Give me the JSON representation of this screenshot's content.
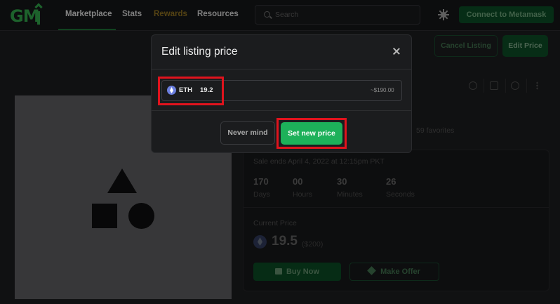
{
  "header": {
    "logo_text": "GM",
    "nav": [
      {
        "label": "Marketplace",
        "color": "#d9d9d9",
        "active": true
      },
      {
        "label": "Stats",
        "color": "#cfcfcf"
      },
      {
        "label": "Rewards",
        "color": "#8a6d1f"
      },
      {
        "label": "Resources",
        "color": "#cfcfcf"
      }
    ],
    "search_placeholder": "Search",
    "theme_icon": "sun-icon",
    "connect_label": "Connect to Metamask"
  },
  "actions": {
    "cancel_label": "Cancel Listing",
    "edit_label": "Edit Price"
  },
  "item": {
    "favorites": "59 favorites",
    "sale_ends": "Sale ends April 4, 2022 at 12:15pm PKT",
    "countdown": [
      {
        "value": "170",
        "label": "Days"
      },
      {
        "value": "00",
        "label": "Hours"
      },
      {
        "value": "30",
        "label": "Minutes"
      },
      {
        "value": "26",
        "label": "Seconds"
      }
    ],
    "current_price_label": "Current Price",
    "price": "19.5",
    "price_usd": "($200)",
    "buy_label": "Buy Now",
    "offer_label": "Make Offer"
  },
  "modal": {
    "title": "Edit listing price",
    "currency": "ETH",
    "price_value": "19.2",
    "usd_estimate": "~$190.00",
    "cancel_label": "Never mind",
    "confirm_label": "Set new price"
  },
  "colors": {
    "accent": "#1db15a",
    "highlight": "#e0131d",
    "eth": "#6b7fde"
  }
}
